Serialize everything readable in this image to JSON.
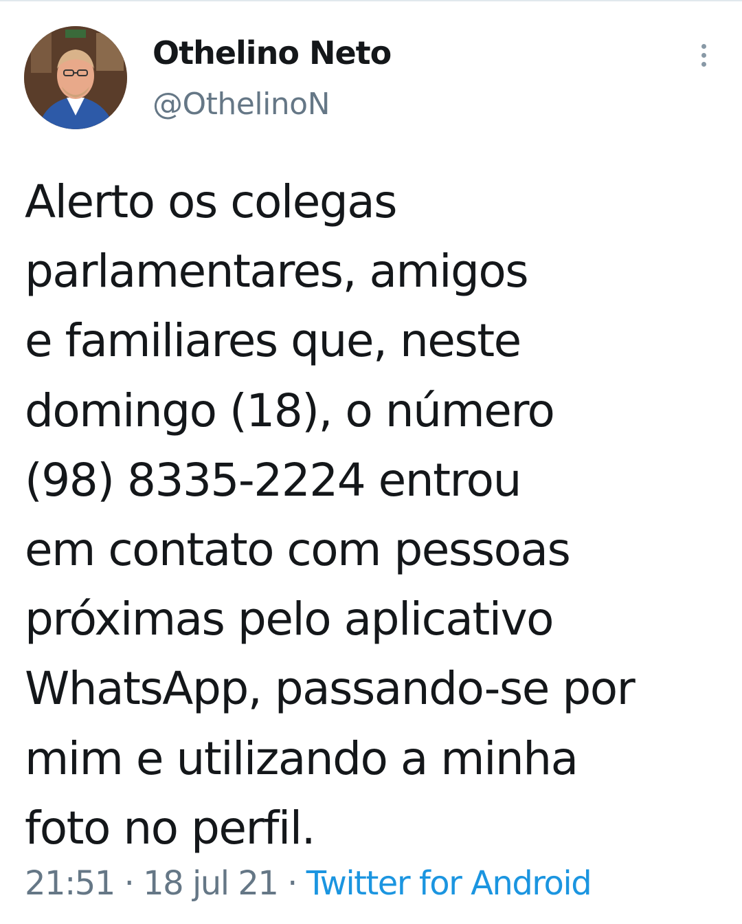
{
  "author": {
    "display_name": "Othelino Neto",
    "handle": "@OthelinoN",
    "avatar_icon": "profile-photo"
  },
  "menu": {
    "icon": "more-vertical-icon"
  },
  "tweet": {
    "lines": [
      "Alerto os colegas",
      "parlamentares, amigos",
      "e familiares que, neste",
      "domingo (18), o número",
      "(98) 8335-2224 entrou",
      "em contato com pessoas",
      "próximas pelo aplicativo",
      "WhatsApp, passando-se por",
      "mim e utilizando a minha",
      "foto no perfil."
    ]
  },
  "meta": {
    "time": "21:51",
    "separator": "·",
    "date": "18 jul 21",
    "source": "Twitter for Android"
  },
  "colors": {
    "text": "#14171a",
    "secondary": "#657786",
    "link": "#1b95e0"
  }
}
